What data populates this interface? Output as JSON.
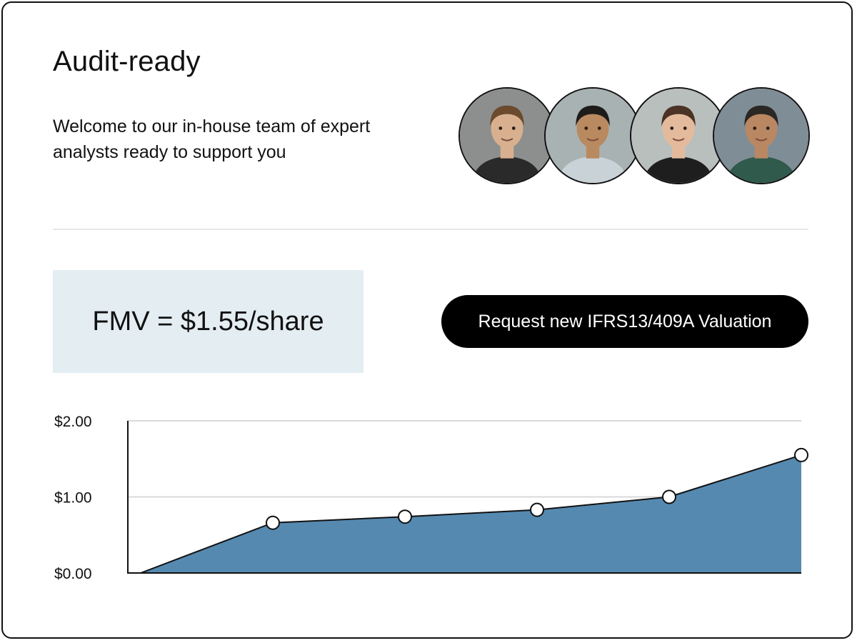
{
  "card": {
    "title": "Audit-ready",
    "subtitle": "Welcome to our in-house team of expert analysts ready to support you"
  },
  "team": {
    "members": [
      {
        "name": "analyst-1",
        "bg": "#8c8f8e",
        "skin": "#d9b08f",
        "hair": "#6b4a2e",
        "shirt": "#2a2a2a"
      },
      {
        "name": "analyst-2",
        "bg": "#a9b2b3",
        "skin": "#b98a5f",
        "hair": "#1e1c1b",
        "shirt": "#c9d2d6"
      },
      {
        "name": "analyst-3",
        "bg": "#b9bfbd",
        "skin": "#e3bb9c",
        "hair": "#4b3325",
        "shirt": "#1e1e1e"
      },
      {
        "name": "analyst-4",
        "bg": "#7f8d96",
        "skin": "#b98762",
        "hair": "#2a2724",
        "shirt": "#2f5a4c"
      }
    ]
  },
  "valuation": {
    "fmv_text": "FMV = $1.55/share"
  },
  "cta": {
    "label": "Request new IFRS13/409A Valuation"
  },
  "colors": {
    "accent_area": "#5589b0",
    "fmv_box_bg": "#e3edf2",
    "button_bg": "#000000",
    "grid": "#d9d9d9"
  },
  "chart_data": {
    "type": "area",
    "x": [
      0,
      1,
      2,
      3,
      4,
      5
    ],
    "values": [
      0.0,
      0.66,
      0.74,
      0.83,
      1.0,
      1.55
    ],
    "ylim": [
      0,
      2
    ],
    "yticks": [
      0,
      1,
      2
    ],
    "ytick_labels": [
      "$0.00",
      "$1.00",
      "$2.00"
    ],
    "markers_on": [
      1,
      2,
      3,
      4,
      5
    ],
    "grid": true,
    "xlabel": "",
    "ylabel": ""
  }
}
